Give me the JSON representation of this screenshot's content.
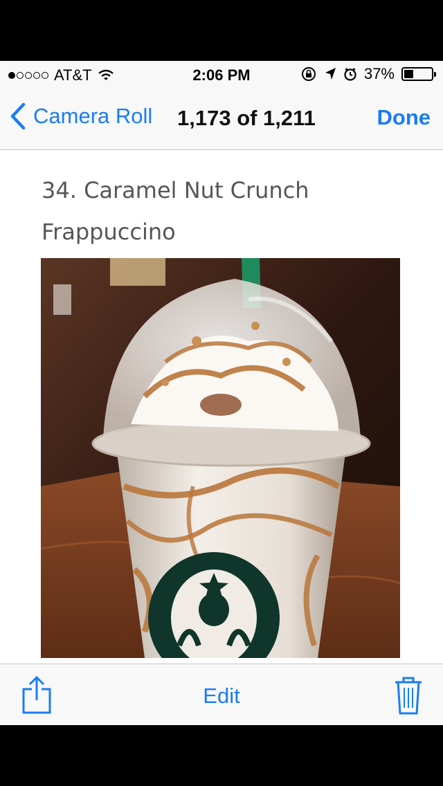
{
  "status_bar": {
    "signal_filled": 1,
    "signal_total": 5,
    "carrier": "AT&T",
    "time": "2:06 PM",
    "battery": "37%",
    "battery_level": 0.37,
    "icons": [
      "wifi-icon",
      "rotation-lock-icon",
      "location-arrow-icon",
      "alarm-icon",
      "battery-icon"
    ]
  },
  "nav": {
    "back_label": "Camera Roll",
    "title": "1,173 of 1,211",
    "done_label": "Done"
  },
  "content": {
    "headline": "34. Caramel Nut Crunch Frappuccino",
    "photo": {
      "subject": "frappuccino-cup-photo",
      "colors": {
        "background": "#3a1e12",
        "table": "#7a3e22",
        "cup": "#ece6df",
        "caramel": "#b9763a",
        "straw": "#1f8a5e",
        "logo": "#10352b"
      }
    }
  },
  "toolbar": {
    "share_icon": "share-icon",
    "edit_label": "Edit",
    "trash_icon": "trash-icon"
  },
  "colors": {
    "accent": "#1a7cf2",
    "bar_background": "#f8f8f8",
    "headline_text": "#555555"
  }
}
